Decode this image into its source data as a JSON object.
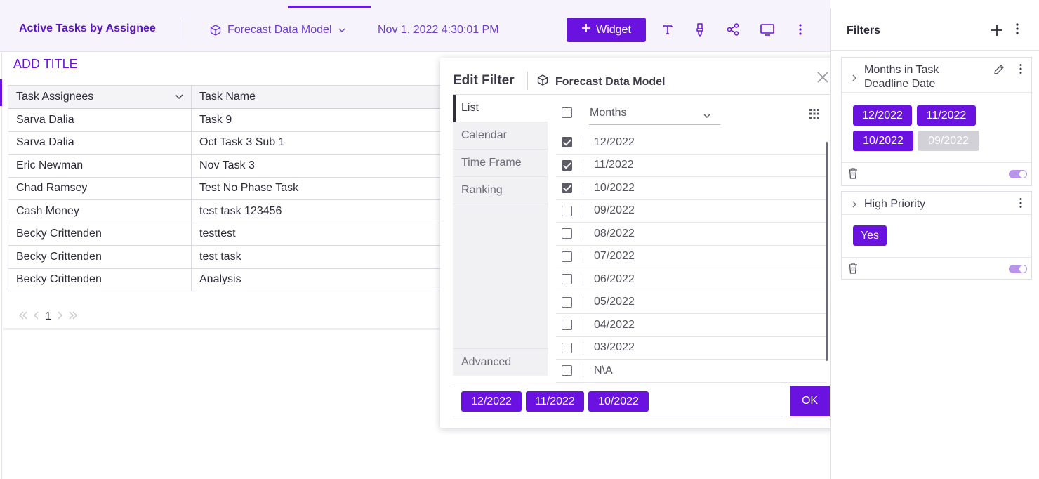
{
  "toolbar": {
    "dashboard_title": "Active Tasks by Assignee",
    "model_name": "Forecast Data Model",
    "timestamp": "Nov 1, 2022 4:30:01 PM",
    "add_widget_label": "Widget",
    "icons": [
      "text-icon",
      "brush-icon",
      "share-icon",
      "monitor-icon",
      "more-vertical-icon"
    ],
    "accent_color": "#6a12e0"
  },
  "widget": {
    "add_title_label": "ADD TITLE",
    "table": {
      "columns": [
        "Task Assignees",
        "Task Name"
      ],
      "rows": [
        [
          "Sarva Dalia",
          "Task 9"
        ],
        [
          "Sarva Dalia",
          "Oct Task 3 Sub 1"
        ],
        [
          "Eric Newman",
          "Nov Task 3"
        ],
        [
          "Chad Ramsey",
          "Test No Phase Task"
        ],
        [
          "Cash Money",
          "test task 123456"
        ],
        [
          "Becky Crittenden",
          "testtest"
        ],
        [
          "Becky Crittenden",
          "test task"
        ],
        [
          "Becky Crittenden",
          "Analysis"
        ]
      ]
    },
    "pager": {
      "current_page": "1"
    }
  },
  "dialog": {
    "title": "Edit Filter",
    "model_name": "Forecast Data Model",
    "tabs": [
      "List",
      "Calendar",
      "Time Frame",
      "Ranking",
      "Advanced"
    ],
    "active_tab": "List",
    "field_select": "Months",
    "items": [
      {
        "label": "12/2022",
        "checked": true
      },
      {
        "label": "11/2022",
        "checked": true
      },
      {
        "label": "10/2022",
        "checked": true
      },
      {
        "label": "09/2022",
        "checked": false
      },
      {
        "label": "08/2022",
        "checked": false
      },
      {
        "label": "07/2022",
        "checked": false
      },
      {
        "label": "06/2022",
        "checked": false
      },
      {
        "label": "05/2022",
        "checked": false
      },
      {
        "label": "04/2022",
        "checked": false
      },
      {
        "label": "03/2022",
        "checked": false
      },
      {
        "label": "N\\A",
        "checked": false
      }
    ],
    "selected_chips": [
      "12/2022",
      "11/2022",
      "10/2022"
    ],
    "ok_label": "OK"
  },
  "filters": {
    "title": "Filters",
    "cards": [
      {
        "name_line1": "Months in Task",
        "name_line2": "Deadline Date",
        "chips": [
          {
            "label": "12/2022",
            "active": true
          },
          {
            "label": "11/2022",
            "active": true
          },
          {
            "label": "10/2022",
            "active": true
          },
          {
            "label": "09/2022",
            "active": false
          }
        ],
        "enabled": true
      },
      {
        "name_line1": "High Priority",
        "chips": [
          {
            "label": "Yes",
            "active": true
          }
        ],
        "enabled": true
      }
    ]
  }
}
